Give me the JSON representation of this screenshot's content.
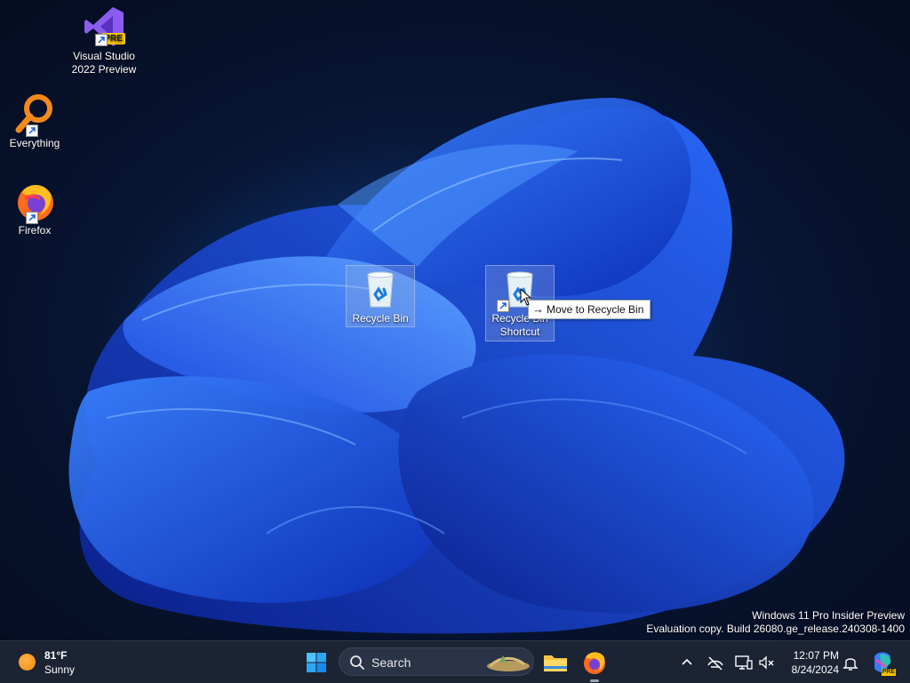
{
  "desktop_icons": {
    "visual_studio": {
      "label_line1": "Visual Studio",
      "label_line2": "2022 Preview",
      "badge": "PRE"
    },
    "everything": {
      "label": "Everything"
    },
    "firefox": {
      "label": "Firefox"
    },
    "recycle_bin": {
      "label": "Recycle Bin"
    },
    "recycle_bin_shortcut": {
      "label_line1": "Recycle Bin",
      "label_line2": "Shortcut"
    }
  },
  "tooltip": {
    "arrow": "→",
    "text": "Move to Recycle Bin"
  },
  "watermark": {
    "line1": "Windows 11 Pro Insider Preview",
    "line2": "Evaluation copy. Build 26080.ge_release.240308-1400"
  },
  "taskbar": {
    "weather": {
      "temperature": "81°F",
      "condition": "Sunny"
    },
    "search": {
      "label": "Search"
    },
    "clock": {
      "time": "12:07 PM",
      "date": "8/24/2024"
    },
    "copilot_badge": "PRE"
  },
  "colors": {
    "taskbar_bg": "#1c2333",
    "wallpaper_blue": "#1f5cff",
    "vs_purple": "#8a5cf0",
    "everything_orange": "#f28a1a"
  },
  "icons": [
    "visual-studio-icon",
    "everything-icon",
    "firefox-icon",
    "recycle-bin-icon",
    "windows-start-icon",
    "search-icon",
    "folder-icon",
    "chevron-up-icon",
    "network-off-icon",
    "display-icon",
    "volume-muted-icon",
    "bell-icon",
    "copilot-icon"
  ]
}
